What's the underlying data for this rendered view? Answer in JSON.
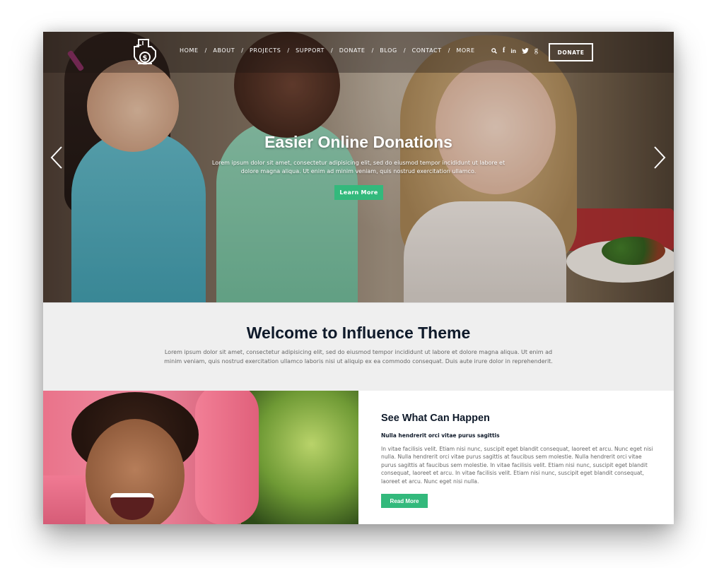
{
  "nav": {
    "logo_alt": "donation-logo",
    "items": [
      {
        "label": "HOME"
      },
      {
        "label": "ABOUT"
      },
      {
        "label": "PROJECTS"
      },
      {
        "label": "SUPPORT"
      },
      {
        "label": "DONATE"
      },
      {
        "label": "BLOG"
      },
      {
        "label": "CONTACT"
      },
      {
        "label": "MORE"
      }
    ],
    "separator": "/",
    "social": [
      {
        "icon": "search-icon",
        "glyph": "⚲"
      },
      {
        "icon": "facebook-icon",
        "glyph": "f"
      },
      {
        "icon": "linkedin-icon",
        "glyph": "in"
      },
      {
        "icon": "twitter-icon",
        "glyph": "🐦"
      },
      {
        "icon": "google-plus-icon",
        "glyph": "g"
      }
    ],
    "donate_label": "DONATE"
  },
  "hero": {
    "title": "Easier Online Donations",
    "text": "Lorem ipsum dolor sit amet, consectetur adipisicing elit, sed do eiusmod tempor incididunt ut labore et dolore magna aliqua. Ut enim ad minim veniam, quis nostrud exercitation ullamco.",
    "button_label": "Learn More",
    "prev_icon": "chevron-left-icon",
    "next_icon": "chevron-right-icon"
  },
  "welcome": {
    "title": "Welcome to Influence Theme",
    "text": "Lorem ipsum dolor sit amet, consectetur adipisicing elit, sed do eiusmod tempor incididunt ut labore et dolore magna aliqua. Ut enim ad minim veniam, quis nostrud exercitation ullamco laboris nisi ut aliquip ex ea commodo consequat. Duis aute irure dolor in reprehenderit."
  },
  "feature": {
    "title": "See What Can Happen",
    "subtitle": "Nulla hendrerit orci vitae purus sagittis",
    "text": "In vitae facilisis velit. Etiam nisi nunc, suscipit eget blandit consequat, laoreet et arcu. Nunc eget nisi nulla. Nulla hendrerit orci vitae purus sagittis at faucibus sem molestie. Nulla hendrerit orci vitae purus sagittis at faucibus sem molestie. In vitae facilisis velit. Etiam nisi nunc, suscipit eget blandit consequat, laoreet et arcu. In vitae facilisis velit. Etiam nisi nunc, suscipit eget blandit consequat, laoreet et arcu. Nunc eget nisi nulla.",
    "button_label": "Read More"
  },
  "colors": {
    "accent_green": "#33b97c",
    "heading_navy": "#0f1a2a",
    "welcome_bg": "#efefef",
    "body_text": "#666666"
  }
}
